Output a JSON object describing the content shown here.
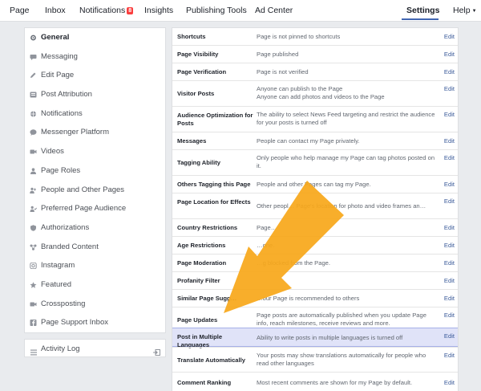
{
  "topnav": {
    "page": "Page",
    "inbox": "Inbox",
    "notifications": "Notifications",
    "notifications_badge": "8",
    "insights": "Insights",
    "publishing_tools": "Publishing Tools",
    "ad_center": "Ad Center",
    "settings": "Settings",
    "help": "Help"
  },
  "sidebar": {
    "items": [
      {
        "label": "General",
        "icon": "gear-icon",
        "active": true
      },
      {
        "label": "Messaging",
        "icon": "messaging-icon"
      },
      {
        "label": "Edit Page",
        "icon": "pencil-icon"
      },
      {
        "label": "Post Attribution",
        "icon": "flag-icon"
      },
      {
        "label": "Notifications",
        "icon": "globe-icon"
      },
      {
        "label": "Messenger Platform",
        "icon": "messenger-icon"
      },
      {
        "label": "Videos",
        "icon": "video-icon"
      },
      {
        "label": "Page Roles",
        "icon": "person-icon"
      },
      {
        "label": "People and Other Pages",
        "icon": "people-icon"
      },
      {
        "label": "Preferred Page Audience",
        "icon": "audience-icon"
      },
      {
        "label": "Authorizations",
        "icon": "authorization-icon"
      },
      {
        "label": "Branded Content",
        "icon": "branded-content-icon"
      },
      {
        "label": "Instagram",
        "icon": "instagram-icon"
      },
      {
        "label": "Featured",
        "icon": "star-icon"
      },
      {
        "label": "Crossposting",
        "icon": "video-icon"
      },
      {
        "label": "Page Support Inbox",
        "icon": "facebook-icon"
      }
    ]
  },
  "activity_log": {
    "label": "Activity Log"
  },
  "settings": {
    "edit_label": "Edit",
    "rows": [
      {
        "label": "Shortcuts",
        "value": "Page is not pinned to shortcuts"
      },
      {
        "label": "Page Visibility",
        "value": "Page published"
      },
      {
        "label": "Page Verification",
        "value": "Page is not verified"
      },
      {
        "label": "Visitor Posts",
        "value": "Anyone can publish to the Page\nAnyone can add photos and videos to the Page"
      },
      {
        "label": "Audience Optimization for Posts",
        "value": "The ability to select News Feed targeting and restrict the audience for your posts is turned off"
      },
      {
        "label": "Messages",
        "value": "People can contact my Page privately."
      },
      {
        "label": "Tagging Ability",
        "value": "Only people who help manage my Page can tag photos posted on it."
      },
      {
        "label": "Others Tagging this Page",
        "value": "People and other Pages can tag my Page."
      },
      {
        "label": "Page Location for Effects",
        "value": "Other peopl… Page's location for photo and video frames an…"
      },
      {
        "label": "Country Restrictions",
        "value": "Page…"
      },
      {
        "label": "Age Restrictions",
        "value": "…one."
      },
      {
        "label": "Page Moderation",
        "value": "…g blocked from the Page."
      },
      {
        "label": "Profanity Filter",
        "value": ""
      },
      {
        "label": "Similar Page Sugg…",
        "value": "…our Page is recommended to others"
      },
      {
        "label": "Page Updates",
        "value": "Page posts are automatically published when you update Page info, reach milestones, receive reviews and more."
      },
      {
        "label": "Post in Multiple Languages",
        "value": "Ability to write posts in multiple languages is turned off",
        "highlight": true
      },
      {
        "label": "Translate Automatically",
        "value": "Your posts may show translations automatically for people who read other languages"
      },
      {
        "label": "Comment Ranking",
        "value": "Most recent comments are shown for my Page by default."
      }
    ]
  },
  "colors": {
    "accent": "#4267b2",
    "link": "#385898",
    "badge": "#fa3e3e",
    "highlight_row": "#e0e3f8",
    "arrow": "#f7a81b"
  }
}
